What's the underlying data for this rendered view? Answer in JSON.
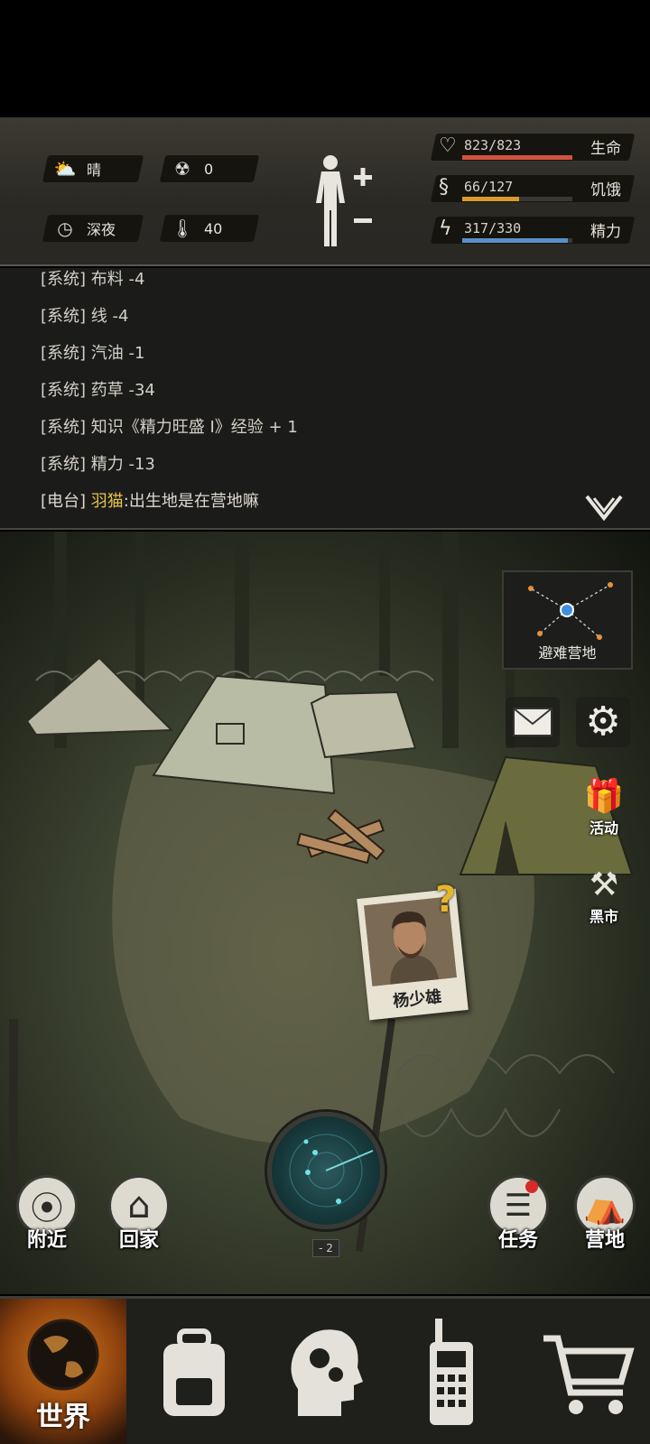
{
  "hud": {
    "weather": {
      "icon": "partly-cloudy-icon",
      "label": "晴"
    },
    "radiation": {
      "icon": "radiation-icon",
      "value": "0"
    },
    "time": {
      "icon": "clock-icon",
      "label": "深夜"
    },
    "temperature": {
      "icon": "thermometer-icon",
      "value": "40"
    },
    "stats": [
      {
        "icon": "heart-icon",
        "value": "823/823",
        "label": "生命",
        "fraction": 1.0,
        "color": "#d2523d"
      },
      {
        "icon": "stomach-icon",
        "value": "66/127",
        "label": "饥饿",
        "fraction": 0.52,
        "color": "#d99a2b"
      },
      {
        "icon": "energy-head-icon",
        "value": "317/330",
        "label": "精力",
        "fraction": 0.96,
        "color": "#5b8fc9"
      }
    ]
  },
  "log": {
    "lines": [
      {
        "prefix": "[系统]",
        "text": " 布料 -4"
      },
      {
        "prefix": "[系统]",
        "text": " 线 -4"
      },
      {
        "prefix": "[系统]",
        "text": " 汽油 -1"
      },
      {
        "prefix": "[系统]",
        "text": " 药草 -34"
      },
      {
        "prefix": "[系统]",
        "text": " 知识《精力旺盛 I》经验 + 1"
      },
      {
        "prefix": "[系统]",
        "text": " 精力 -13"
      }
    ],
    "radio": {
      "prefix": "[电台]",
      "speaker": " 羽猫",
      "text": ":出生地是在营地嘛"
    }
  },
  "scene": {
    "map_label": "避难营地",
    "side_buttons": {
      "events": "活动",
      "black_market": "黑市"
    },
    "npc_name": "杨少雄",
    "radar_level": "- 2",
    "round_buttons": {
      "nearby": "附近",
      "home": "回家",
      "tasks": "任务",
      "camp": "营地"
    }
  },
  "nav": {
    "world": "世界"
  },
  "colors": {
    "accent_orange": "#d57a1e",
    "question_mark": "#e7b52a",
    "speaker_name": "#e7c44a"
  }
}
